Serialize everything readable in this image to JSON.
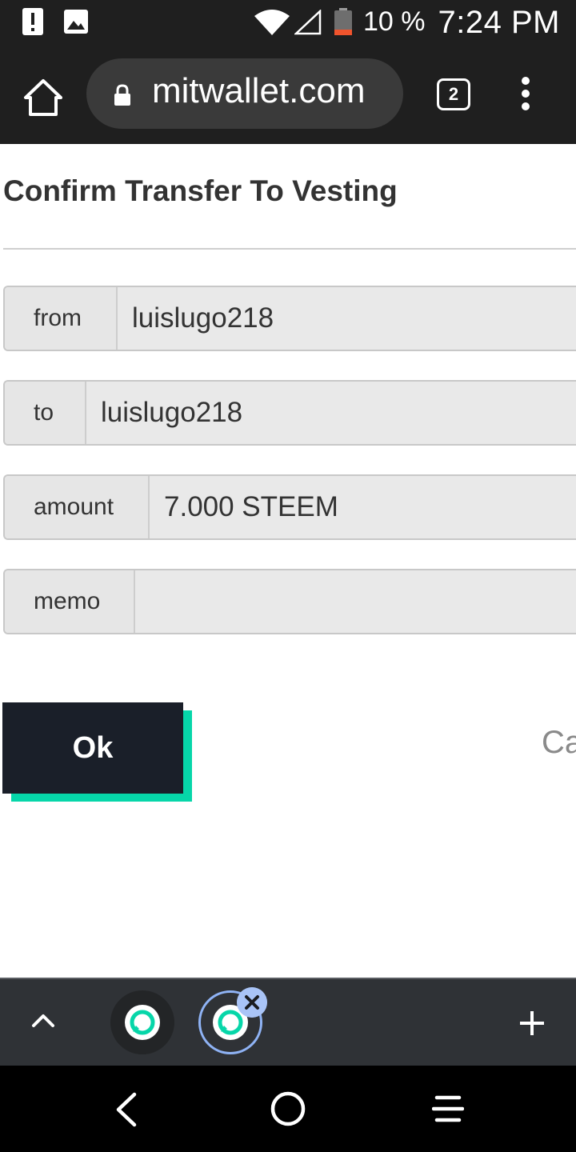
{
  "status_bar": {
    "battery_percent": "10 %",
    "time": "7:24 PM",
    "icons": [
      "alert-icon",
      "image-icon",
      "wifi-icon",
      "cell-signal-icon",
      "battery-icon"
    ]
  },
  "browser": {
    "url": "mitwallet.com",
    "tab_count": "2",
    "icons": [
      "home-icon",
      "lock-icon",
      "tabs-icon",
      "more-vert-icon"
    ]
  },
  "page": {
    "title": "Confirm Transfer To Vesting",
    "fields": [
      {
        "label": "from",
        "value": "luislugo218"
      },
      {
        "label": "to",
        "value": "luislugo218"
      },
      {
        "label": "amount",
        "value": "7.000 STEEM"
      },
      {
        "label": "memo",
        "value": ""
      }
    ],
    "ok_label": "Ok",
    "cancel_label": "Ca"
  },
  "tab_strip": {
    "icons": [
      "chevron-up-icon",
      "tab-favicon-icon",
      "close-icon",
      "plus-icon"
    ]
  },
  "nav_bar": {
    "icons": [
      "back-icon",
      "home-circle-icon",
      "recents-icon"
    ]
  },
  "colors": {
    "accent": "#06d6a9",
    "button_dark": "#1a1f29",
    "chrome": "#1f1f1f"
  }
}
